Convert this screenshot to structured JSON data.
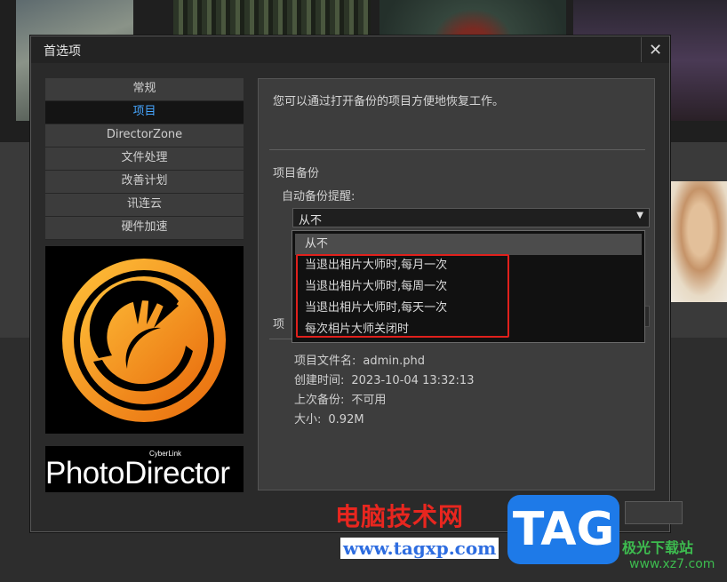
{
  "dialog": {
    "title": "首选项",
    "close_glyph": "✕"
  },
  "nav": {
    "items": [
      {
        "label": "常规"
      },
      {
        "label": "项目"
      },
      {
        "label": "DirectorZone"
      },
      {
        "label": "文件处理"
      },
      {
        "label": "改善计划"
      },
      {
        "label": "讯连云"
      },
      {
        "label": "硬件加速"
      }
    ],
    "active_index": 1
  },
  "brand": {
    "company": "CyberLink",
    "product": "PhotoDirector"
  },
  "panel": {
    "description": "您可以通过打开备份的项目方便地恢复工作。",
    "backup_section_title": "项目备份",
    "auto_backup_label": "自动备份提醒:",
    "selected_value": "从不",
    "behind_button": "...",
    "section2_title": "项",
    "info": {
      "file_label": "项目文件名:",
      "file_value": "admin.phd",
      "created_label": "创建时间:",
      "created_value": "2023-10-04 13:32:13",
      "last_backup_label": "上次备份:",
      "last_backup_value": "不可用",
      "size_label": "大小:",
      "size_value": "0.92M"
    }
  },
  "dropdown": {
    "options": [
      "从不",
      "当退出相片大师时,每月一次",
      "当退出相片大师时,每周一次",
      "当退出相片大师时,每天一次",
      "每次相片大师关闭时"
    ],
    "selected_index": 0
  },
  "watermark": {
    "text": "电脑技术网",
    "url": "www.tagxp.com",
    "badge": "TAG",
    "site_name": "极光下载站",
    "site_url": "www.xz7.com"
  },
  "colors": {
    "accent": "#46a6ff",
    "highlight_border": "#e0201c",
    "logo_orange": "#f5a316"
  }
}
